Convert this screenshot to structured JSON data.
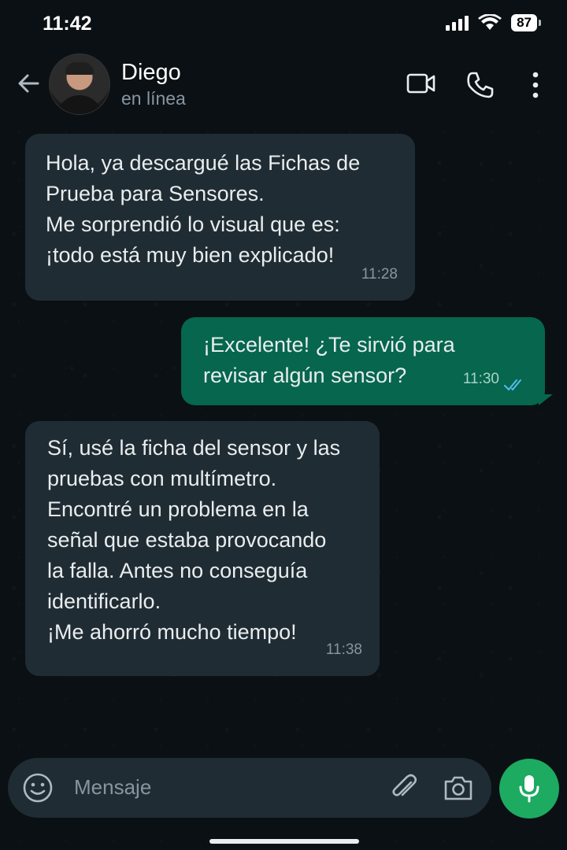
{
  "status_bar": {
    "time": "11:42",
    "battery": "87"
  },
  "header": {
    "contact_name": "Diego",
    "contact_status": "en línea"
  },
  "messages": [
    {
      "direction": "incoming",
      "text": "Hola, ya descargué las Fichas de\nPrueba para Sensores.\nMe sorprendió lo visual que es:\n¡todo está muy bien explicado!",
      "time": "11:28"
    },
    {
      "direction": "outgoing",
      "text": "¡Excelente! ¿Te sirvió para\nrevisar algún sensor?",
      "time": "11:30",
      "read": true
    },
    {
      "direction": "incoming",
      "text": "Sí, usé la ficha del sensor y las\npruebas con multímetro.\nEncontré un problema en la\nseñal que estaba provocando\nla falla. Antes no conseguía\nidentificarlo.\n¡Me ahorró mucho tiempo!",
      "time": "11:38"
    }
  ],
  "composer": {
    "placeholder": "Mensaje"
  },
  "colors": {
    "background": "#0b1014",
    "incoming_bubble": "#202c33",
    "outgoing_bubble": "#06664e",
    "accent": "#1daa61",
    "read_ticks": "#53bdeb"
  },
  "icons": [
    "back-arrow-icon",
    "video-call-icon",
    "phone-icon",
    "more-vertical-icon",
    "emoji-icon",
    "attach-icon",
    "camera-icon",
    "microphone-icon",
    "signal-icon",
    "wifi-icon",
    "battery-icon",
    "double-check-icon"
  ]
}
